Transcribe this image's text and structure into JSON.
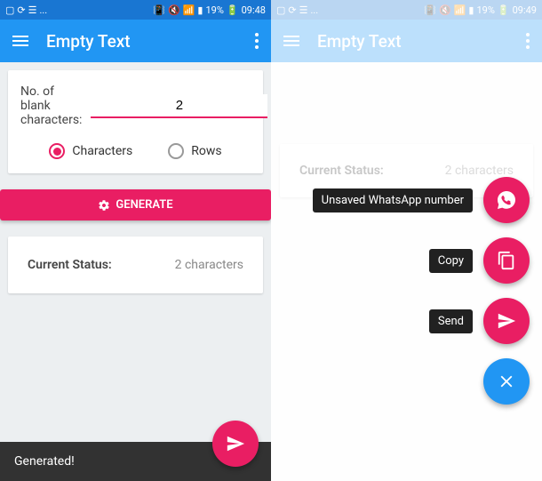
{
  "left": {
    "status": {
      "left": "...",
      "battery": "19%",
      "time": "09:48"
    },
    "appbar": {
      "title": "Empty Text"
    },
    "input": {
      "label": "No. of blank characters:",
      "value": "2"
    },
    "radios": {
      "opt1": "Characters",
      "opt2": "Rows"
    },
    "button": {
      "generate": "GENERATE"
    },
    "status_card": {
      "label": "Current Status:",
      "value": "2 characters"
    },
    "snackbar": "Generated!"
  },
  "right": {
    "status": {
      "left": "...",
      "battery": "19%",
      "time": "09:49"
    },
    "appbar": {
      "title": "Empty Text"
    },
    "status_card": {
      "label": "Current Status:",
      "value": "2 characters"
    },
    "fab": {
      "whatsapp": "Unsaved WhatsApp number",
      "copy": "Copy",
      "send": "Send"
    }
  }
}
